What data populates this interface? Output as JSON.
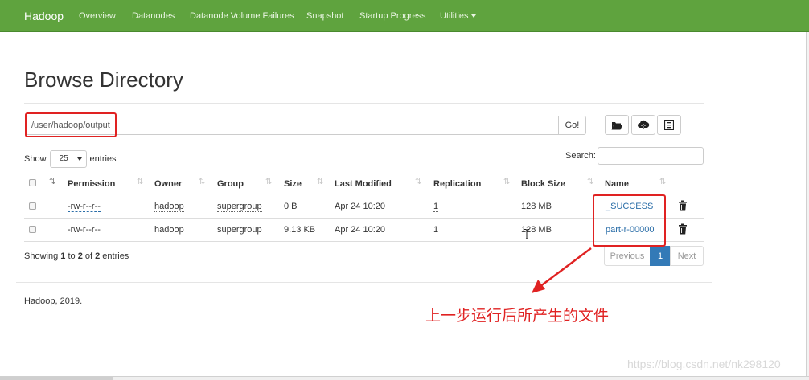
{
  "navbar": {
    "brand": "Hadoop",
    "items": [
      "Overview",
      "Datanodes",
      "Datanode Volume Failures",
      "Snapshot",
      "Startup Progress",
      "Utilities"
    ]
  },
  "page": {
    "title": "Browse Directory",
    "path_value": "/user/hadoop/output",
    "go_label": "Go!"
  },
  "toolbar_icons": [
    "folder-open-icon",
    "cloud-upload-icon",
    "list-icon"
  ],
  "table_controls": {
    "show_label": "Show",
    "page_size": "25",
    "entries_label": "entries",
    "search_label": "Search:"
  },
  "columns": [
    "Permission",
    "Owner",
    "Group",
    "Size",
    "Last Modified",
    "Replication",
    "Block Size",
    "Name"
  ],
  "rows": [
    {
      "permission": "-rw-r--r--",
      "owner": "hadoop",
      "group": "supergroup",
      "size": "0 B",
      "modified": "Apr 24 10:20",
      "replication": "1",
      "block_size": "128 MB",
      "name": "_SUCCESS"
    },
    {
      "permission": "-rw-r--r--",
      "owner": "hadoop",
      "group": "supergroup",
      "size": "9.13 KB",
      "modified": "Apr 24 10:20",
      "replication": "1",
      "block_size": "128 MB",
      "name": "part-r-00000"
    }
  ],
  "info": {
    "prefix": "Showing ",
    "from": "1",
    "mid1": " to ",
    "to": "2",
    "mid2": " of ",
    "total": "2",
    "suffix": " entries"
  },
  "pagination": {
    "previous": "Previous",
    "current": "1",
    "next": "Next"
  },
  "footer": "Hadoop, 2019.",
  "annotation": "上一步运行后所产生的文件",
  "watermark": "https://blog.csdn.net/nk298120",
  "colors": {
    "navbar": "#5fa33e",
    "link": "#2b6ea8",
    "annotation_red": "#e02222",
    "pager_active": "#337ab7"
  }
}
